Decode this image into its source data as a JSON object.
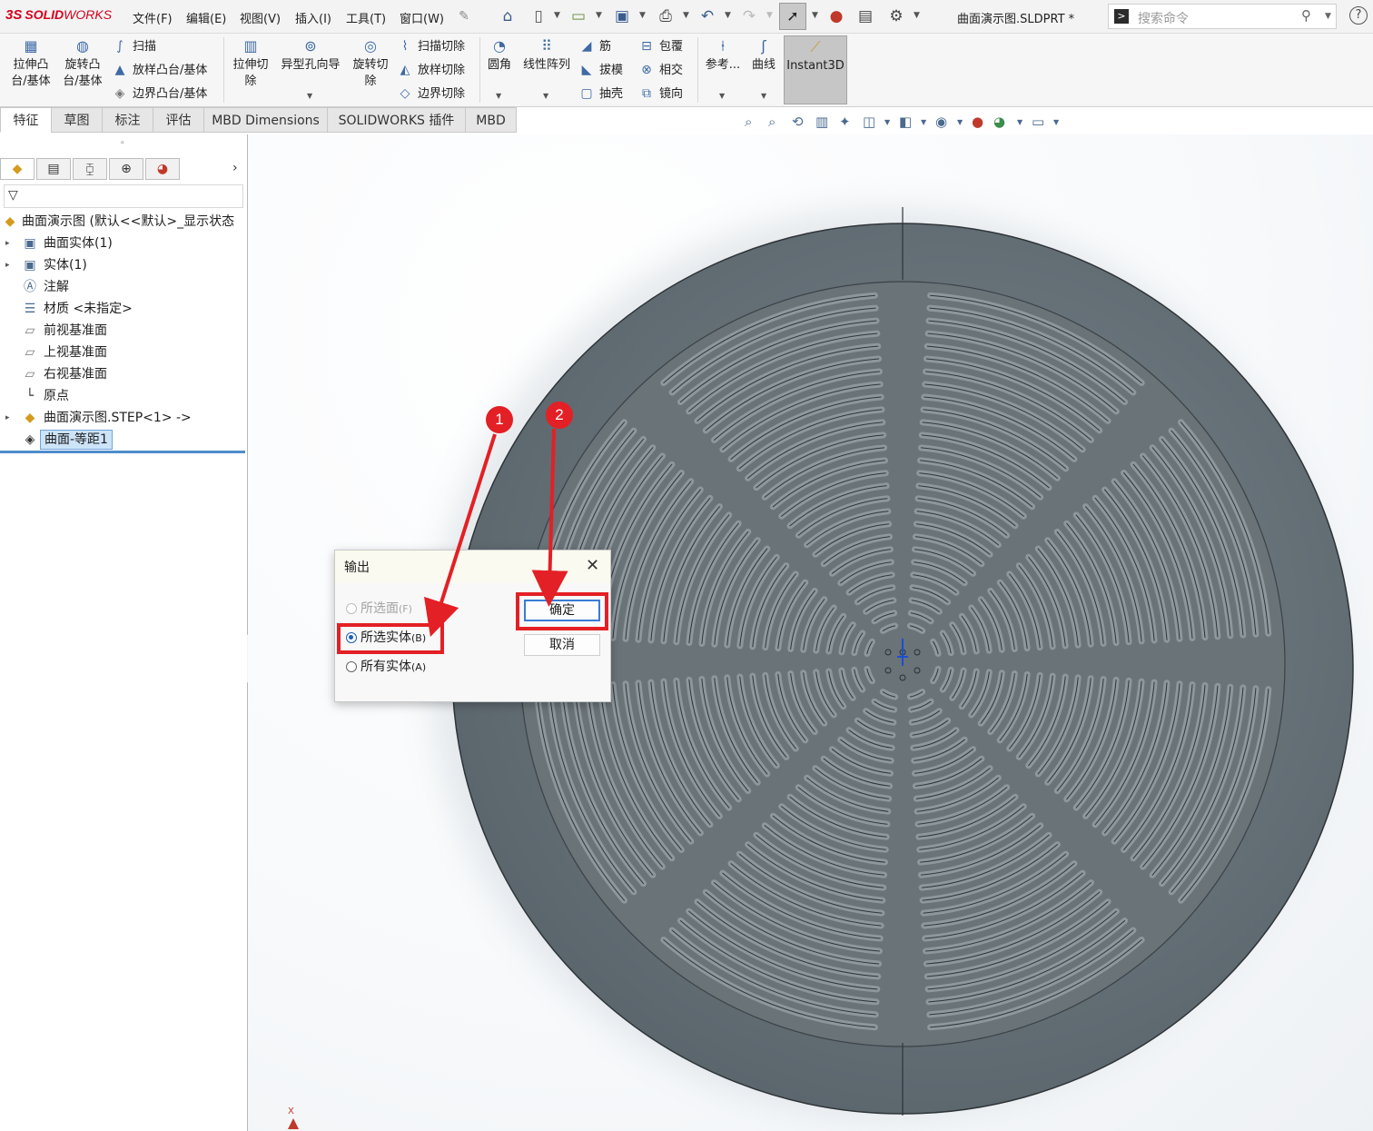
{
  "app": {
    "logo_ds": "3S",
    "logo_solid": "SOLID",
    "logo_works": "WORKS",
    "document_title": "曲面演示图.SLDPRT *"
  },
  "menu": [
    "文件(F)",
    "编辑(E)",
    "视图(V)",
    "插入(I)",
    "工具(T)",
    "窗口(W)"
  ],
  "search": {
    "placeholder": "搜索命令"
  },
  "ribbon": {
    "extrude_boss": [
      "拉伸凸",
      "台/基体"
    ],
    "revolve_boss": [
      "旋转凸",
      "台/基体"
    ],
    "sweep": "扫描",
    "loft_boss": "放样凸台/基体",
    "boundary_boss": "边界凸台/基体",
    "extrude_cut": [
      "拉伸切",
      "除"
    ],
    "hole_wizard": "异型孔向导",
    "revolve_cut": [
      "旋转切",
      "除"
    ],
    "swept_cut": "扫描切除",
    "lofted_cut": "放样切除",
    "boundary_cut": "边界切除",
    "fillet": "圆角",
    "linear_pattern": "线性阵列",
    "rib": "筋",
    "draft": "拔模",
    "shell": "抽壳",
    "wrap": "包覆",
    "intersect": "相交",
    "mirror": "镜向",
    "reference": "参考...",
    "curves": "曲线",
    "instant3d": "Instant3D"
  },
  "tabs": [
    "特征",
    "草图",
    "标注",
    "评估",
    "MBD Dimensions",
    "SOLIDWORKS 插件",
    "MBD"
  ],
  "tree": {
    "root": "曲面演示图 (默认<<默认>_显示状态",
    "items": [
      "曲面实体(1)",
      "实体(1)",
      "注解",
      "材质 <未指定>",
      "前视基准面",
      "上视基准面",
      "右视基准面",
      "原点",
      "曲面演示图.STEP<1> ->",
      "曲面-等距1"
    ]
  },
  "triad": {
    "x_label": "X"
  },
  "dialog": {
    "title": "输出",
    "options": [
      {
        "label": "所选面",
        "key": "(F)",
        "state": "disabled"
      },
      {
        "label": "所选实体",
        "key": "(B)",
        "state": "checked"
      },
      {
        "label": "所有实体",
        "key": "(A)",
        "state": "unchecked"
      }
    ],
    "ok": "确定",
    "cancel": "取消"
  },
  "annotations": {
    "badge1": "1",
    "badge2": "2"
  },
  "colors": {
    "accent_red": "#e32025",
    "part_gray": "#646e76",
    "select_blue": "#1b5fb8"
  }
}
